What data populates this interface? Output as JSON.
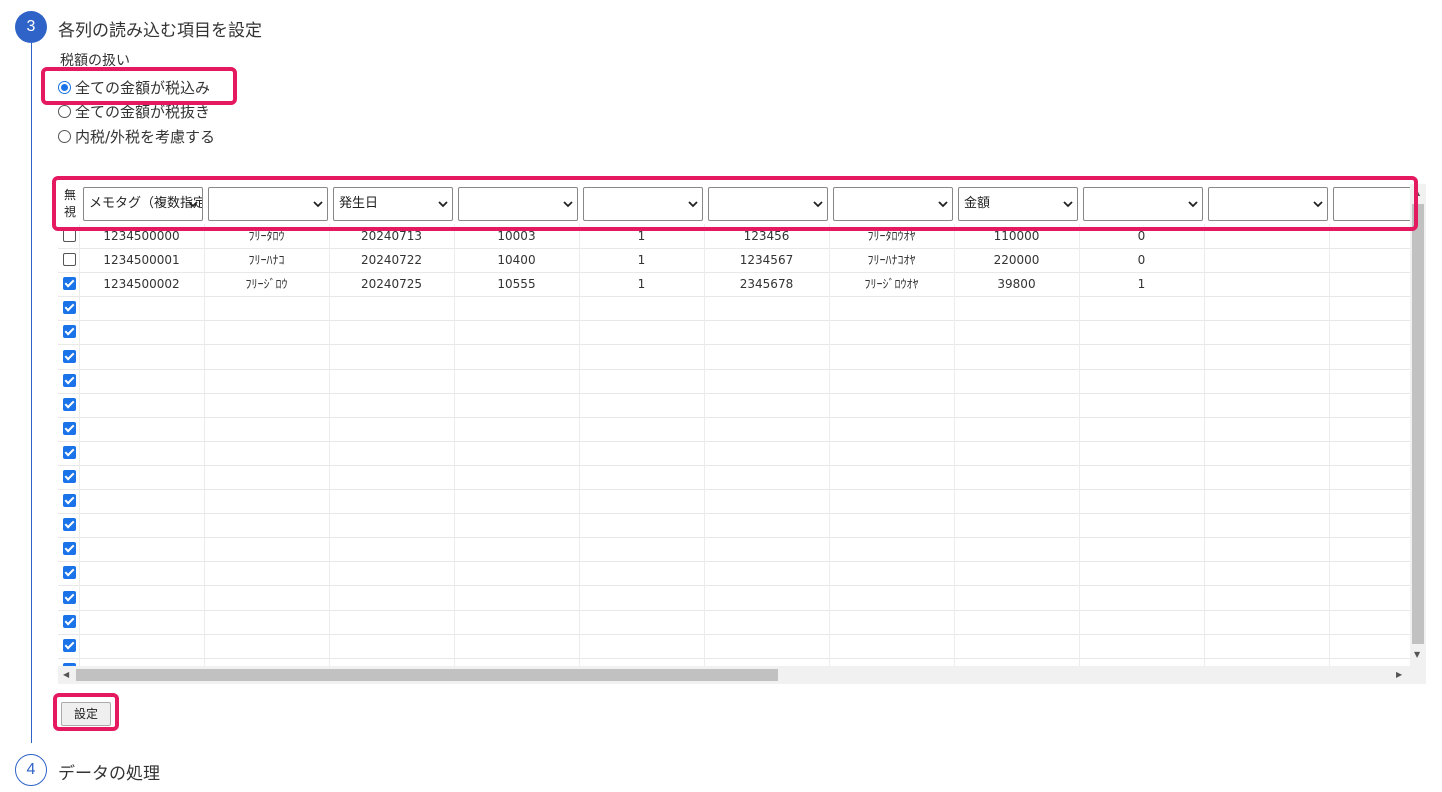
{
  "step3": {
    "number": "3",
    "title": "各列の読み込む項目を設定"
  },
  "step4": {
    "number": "4",
    "title": "データの処理"
  },
  "tax": {
    "label": "税額の扱い",
    "options": [
      "全ての金額が税込み",
      "全ての金額が税抜き",
      "内税/外税を考慮する"
    ],
    "selected_index": 0
  },
  "grid": {
    "ignore_header": [
      "無",
      "視"
    ],
    "column_selects": [
      "メモタグ（複数指定可）",
      "",
      "発生日",
      "",
      "",
      "",
      "",
      "金額",
      "",
      "",
      ""
    ],
    "rows": [
      {
        "ignored": false,
        "cells": [
          "1234500000",
          "ﾌﾘｰﾀﾛｳ",
          "20240713",
          "10003",
          "1",
          "123456",
          "ﾌﾘｰﾀﾛｳｵﾔ",
          "110000",
          "0",
          "",
          ""
        ]
      },
      {
        "ignored": false,
        "cells": [
          "1234500001",
          "ﾌﾘｰﾊﾅｺ",
          "20240722",
          "10400",
          "1",
          "1234567",
          "ﾌﾘｰﾊﾅｺｵﾔ",
          "220000",
          "0",
          "",
          ""
        ]
      },
      {
        "ignored": true,
        "cells": [
          "1234500002",
          "ﾌﾘｰｼﾞﾛｳ",
          "20240725",
          "10555",
          "1",
          "2345678",
          "ﾌﾘｰｼﾞﾛｳｵﾔ",
          "39800",
          "1",
          "",
          ""
        ]
      }
    ],
    "empty_checked_rows": 15
  },
  "buttons": {
    "set": "設定"
  },
  "colors": {
    "accent": "#2f63c8",
    "highlight": "#e5195f",
    "checkbox": "#1a73e8"
  }
}
